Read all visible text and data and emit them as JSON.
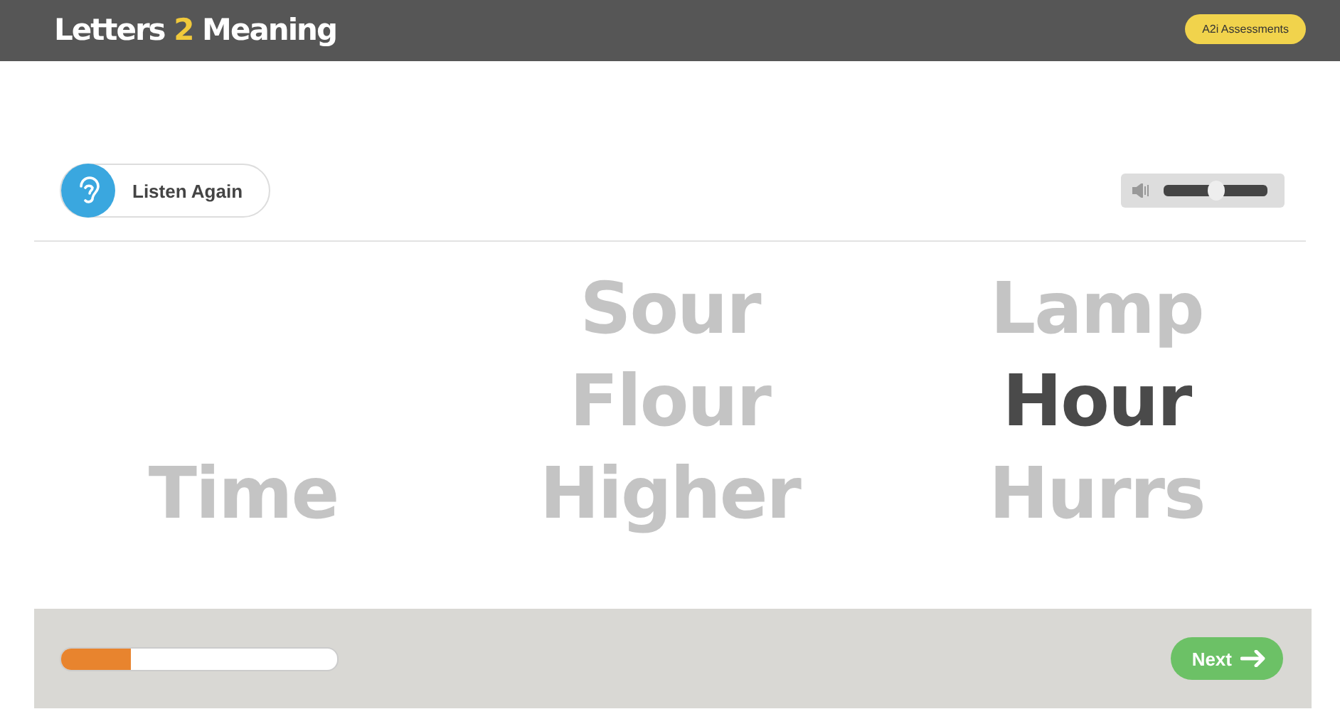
{
  "header": {
    "logo_parts": [
      "Letters ",
      "2",
      " Meaning"
    ],
    "badge": "A2i Assessments"
  },
  "toolbar": {
    "listen_button": "Listen Again",
    "volume": {
      "level": 0.5
    }
  },
  "word_columns": [
    {
      "words": [
        {
          "text": "Time",
          "selected": false
        }
      ]
    },
    {
      "words": [
        {
          "text": "Sour",
          "selected": false
        },
        {
          "text": "Flour",
          "selected": false
        },
        {
          "text": "Higher",
          "selected": false
        }
      ]
    },
    {
      "words": [
        {
          "text": "Lamp",
          "selected": false
        },
        {
          "text": "Hour",
          "selected": true
        },
        {
          "text": "Hurrs",
          "selected": false
        }
      ]
    }
  ],
  "footer": {
    "progress": {
      "level": 0.25
    },
    "next_button": "Next"
  }
}
